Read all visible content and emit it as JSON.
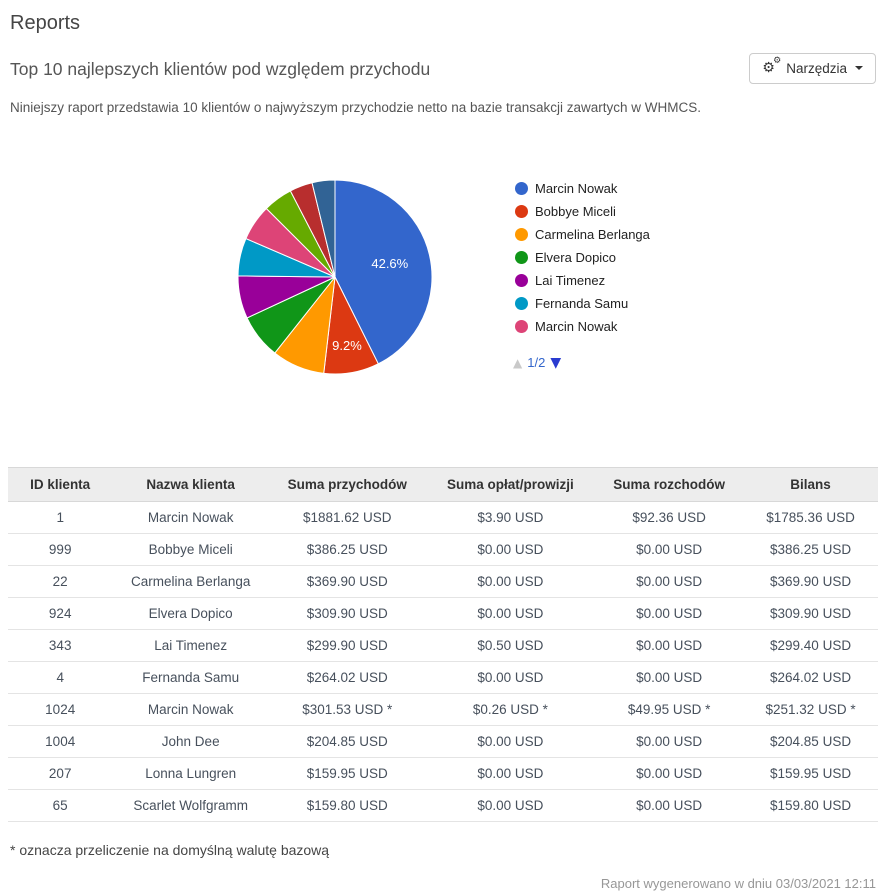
{
  "page": {
    "title": "Reports",
    "report_title": "Top 10 najlepszych klientów pod względem przychodu",
    "description": "Niniejszy raport przedstawia 10 klientów o najwyższym przychodzie netto na bazie transakcji zawartych w WHMCS.",
    "tools_button_label": "Narzędzia",
    "tools_button_icon": "gears-icon",
    "footnote": "* oznacza przeliczenie na domyślną walutę bazową",
    "generated": "Raport wygenerowano w dniu 03/03/2021 12:11"
  },
  "chart_data": {
    "type": "pie",
    "title": "",
    "start_angle_deg": 0,
    "direction": "clockwise",
    "legend_position": "right",
    "slices": [
      {
        "label": "Marcin Nowak",
        "value": 42.6,
        "color": "#3366CC",
        "display_label": "42.6%"
      },
      {
        "label": "Bobbye Miceli",
        "value": 9.2,
        "color": "#DC3912",
        "display_label": "9.2%"
      },
      {
        "label": "Carmelina Berlanga",
        "value": 8.8,
        "color": "#FF9900",
        "display_label": ""
      },
      {
        "label": "Elvera Dopico",
        "value": 7.4,
        "color": "#109618",
        "display_label": ""
      },
      {
        "label": "Lai Timenez",
        "value": 7.1,
        "color": "#990099",
        "display_label": ""
      },
      {
        "label": "Fernanda Samu",
        "value": 6.3,
        "color": "#0099C6",
        "display_label": ""
      },
      {
        "label": "Marcin Nowak",
        "value": 6.0,
        "color": "#DD4477",
        "display_label": ""
      },
      {
        "label": "John Dee",
        "value": 4.9,
        "color": "#66AA00",
        "display_label": ""
      },
      {
        "label": "Lonna Lungren",
        "value": 3.8,
        "color": "#B82E2E",
        "display_label": ""
      },
      {
        "label": "Scarlet Wolfgramm",
        "value": 3.8,
        "color": "#316395",
        "display_label": ""
      }
    ],
    "legend_visible_count": 7,
    "legend_page": "1/2",
    "legend_pager": {
      "up_icon": "triangle-up",
      "down_icon": "triangle-down",
      "up_enabled": false,
      "down_enabled": true
    }
  },
  "table": {
    "headers": [
      "ID klienta",
      "Nazwa klienta",
      "Suma przychodów",
      "Suma opłat/prowizji",
      "Suma rozchodów",
      "Bilans"
    ],
    "rows": [
      [
        "1",
        "Marcin Nowak",
        "$1881.62 USD",
        "$3.90 USD",
        "$92.36 USD",
        "$1785.36 USD"
      ],
      [
        "999",
        "Bobbye Miceli",
        "$386.25 USD",
        "$0.00 USD",
        "$0.00 USD",
        "$386.25 USD"
      ],
      [
        "22",
        "Carmelina Berlanga",
        "$369.90 USD",
        "$0.00 USD",
        "$0.00 USD",
        "$369.90 USD"
      ],
      [
        "924",
        "Elvera Dopico",
        "$309.90 USD",
        "$0.00 USD",
        "$0.00 USD",
        "$309.90 USD"
      ],
      [
        "343",
        "Lai Timenez",
        "$299.90 USD",
        "$0.50 USD",
        "$0.00 USD",
        "$299.40 USD"
      ],
      [
        "4",
        "Fernanda Samu",
        "$264.02 USD",
        "$0.00 USD",
        "$0.00 USD",
        "$264.02 USD"
      ],
      [
        "1024",
        "Marcin Nowak",
        "$301.53 USD *",
        "$0.26 USD *",
        "$49.95 USD *",
        "$251.32 USD *"
      ],
      [
        "1004",
        "John Dee",
        "$204.85 USD",
        "$0.00 USD",
        "$0.00 USD",
        "$204.85 USD"
      ],
      [
        "207",
        "Lonna Lungren",
        "$159.95 USD",
        "$0.00 USD",
        "$0.00 USD",
        "$159.95 USD"
      ],
      [
        "65",
        "Scarlet Wolfgramm",
        "$159.80 USD",
        "$0.00 USD",
        "$0.00 USD",
        "$159.80 USD"
      ]
    ]
  }
}
